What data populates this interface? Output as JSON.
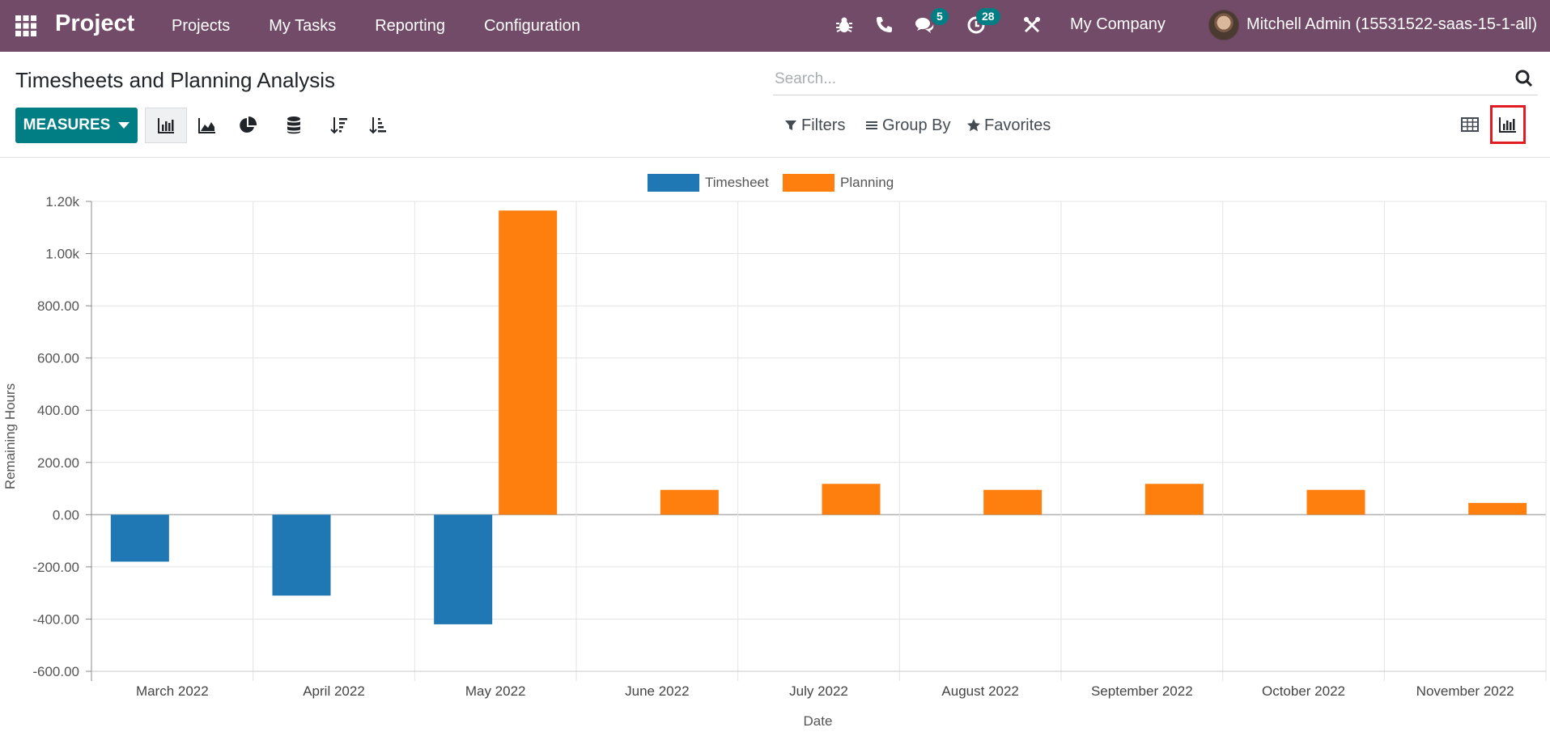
{
  "navbar": {
    "app_name": "Project",
    "menu": [
      "Projects",
      "My Tasks",
      "Reporting",
      "Configuration"
    ],
    "messages_badge": "5",
    "activities_badge": "28",
    "company": "My Company",
    "user": "Mitchell Admin (15531522-saas-15-1-all)",
    "icons": [
      "apps-icon",
      "bug-icon",
      "phone-icon",
      "chat-icon",
      "clock-icon",
      "tools-icon"
    ]
  },
  "control_panel": {
    "title": "Timesheets and Planning Analysis",
    "search_placeholder": "Search...",
    "measures_label": "MEASURES",
    "filters_label": "Filters",
    "group_by_label": "Group By",
    "favorites_label": "Favorites"
  },
  "colors": {
    "brand": "#714B67",
    "accent": "#017E84",
    "timesheet": "#1F77B4",
    "planning": "#FF7F0E",
    "highlight_box": "#E31B23"
  },
  "chart_data": {
    "type": "bar",
    "categories": [
      "March 2022",
      "April 2022",
      "May 2022",
      "June 2022",
      "July 2022",
      "August 2022",
      "September 2022",
      "October 2022",
      "November 2022"
    ],
    "series": [
      {
        "name": "Timesheet",
        "color": "#1F77B4",
        "values": [
          -180,
          -310,
          -420,
          0,
          0,
          0,
          0,
          0,
          0
        ]
      },
      {
        "name": "Planning",
        "color": "#FF7F0E",
        "values": [
          0,
          0,
          1165,
          95,
          118,
          95,
          118,
          95,
          45
        ]
      }
    ],
    "xlabel": "Date",
    "ylabel": "Remaining Hours",
    "ylim": [
      -600,
      1200
    ],
    "yticks": [
      "-600.00",
      "-400.00",
      "-200.00",
      "0.00",
      "200.00",
      "400.00",
      "600.00",
      "800.00",
      "1.00k",
      "1.20k"
    ],
    "legend_position": "top-center",
    "grid": true
  }
}
